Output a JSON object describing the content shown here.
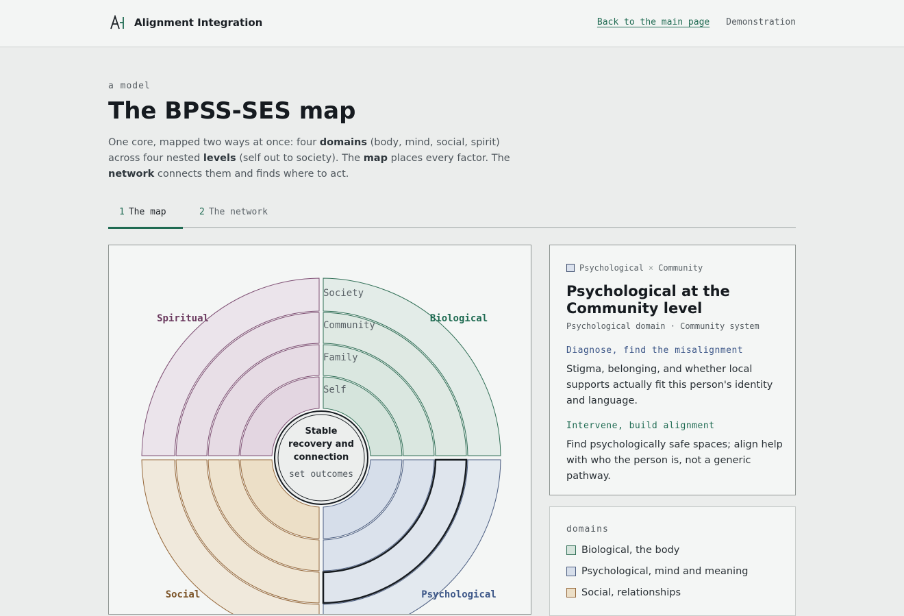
{
  "header": {
    "brand_name": "Alignment Integration",
    "nav": {
      "back_link": "Back to the main page",
      "demo_link": "Demonstration"
    }
  },
  "intro": {
    "eyebrow": "a model",
    "title": "The BPSS-SES map",
    "lead": {
      "t1": "One core, mapped two ways at once: four ",
      "b1": "domains",
      "t2": " (body, mind, social, spirit) across four nested ",
      "b2": "levels",
      "t3": " (self out to society). The ",
      "b3": "map",
      "t4": " places every factor. The ",
      "b4": "network",
      "t5": " connects them and finds where to act."
    }
  },
  "tabs": [
    {
      "num": "1",
      "label": "The map",
      "active": true
    },
    {
      "num": "2",
      "label": "The network",
      "active": false
    }
  ],
  "map": {
    "core": {
      "line1": "Stable",
      "line2": "recovery and",
      "line3": "connection",
      "line4": "set outcomes"
    },
    "levels": [
      "Self",
      "Family",
      "Community",
      "Society"
    ],
    "domains": [
      {
        "key": "spiritual",
        "label": "Spiritual",
        "fill": "#e3d6e1",
        "stroke": "#7d4d72",
        "text": "#6b3a5f"
      },
      {
        "key": "biological",
        "label": "Biological",
        "fill": "#d5e4dc",
        "stroke": "#2f6e55",
        "text": "#1f6b52"
      },
      {
        "key": "psychological",
        "label": "Psychological",
        "fill": "#d6deea",
        "stroke": "#4a5c80",
        "text": "#3d5788"
      },
      {
        "key": "social",
        "label": "Social",
        "fill": "#ecdfc7",
        "stroke": "#96683a",
        "text": "#7b5428"
      }
    ],
    "selected": {
      "domain": "psychological",
      "level": "Community"
    }
  },
  "detail": {
    "crumb_domain": "Psychological",
    "crumb_sep": "×",
    "crumb_level": "Community",
    "title": "Psychological at the Community level",
    "subtitle": "Psychological domain · Community system",
    "diagnose_label": "Diagnose, find the misalignment",
    "diagnose_text": "Stigma, belonging, and whether local supports actually fit this person's identity and language.",
    "intervene_label": "Intervene, build alignment",
    "intervene_text": "Find psychologically safe spaces; align help with who the person is, not a generic pathway."
  },
  "legend": {
    "title": "domains",
    "items": [
      {
        "label": "Biological, the body",
        "color": "#d5e4dc",
        "border": "#2f6e55"
      },
      {
        "label": "Psychological, mind and meaning",
        "color": "#d6deea",
        "border": "#4a5c80"
      },
      {
        "label": "Social, relationships",
        "color": "#ecdfc7",
        "border": "#96683a"
      }
    ]
  }
}
